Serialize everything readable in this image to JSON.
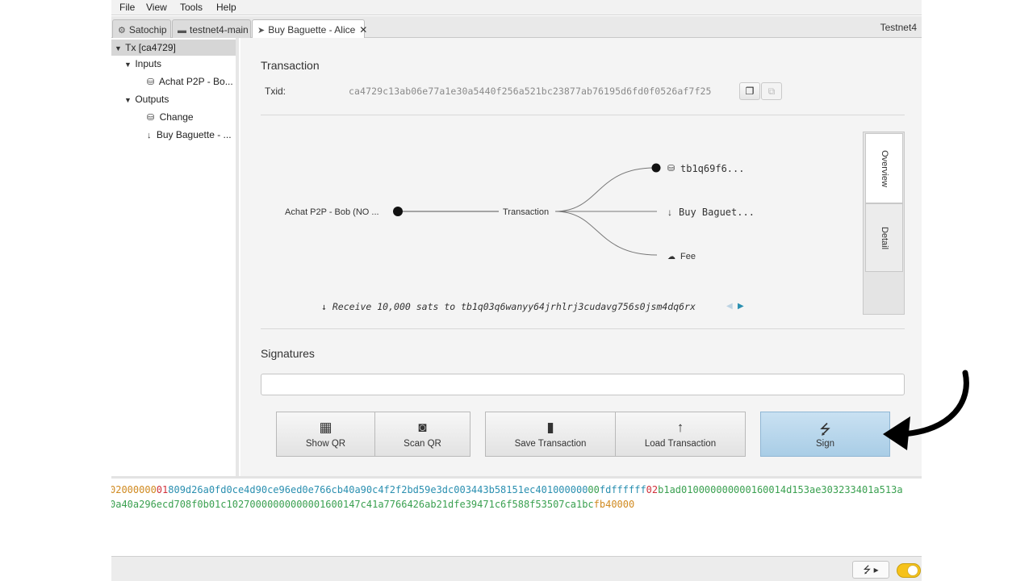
{
  "menu": [
    "File",
    "View",
    "Tools",
    "Help"
  ],
  "tabs": [
    {
      "label": "Satochip",
      "icon": "satochip-icon"
    },
    {
      "label": "testnet4-main",
      "icon": "wallet-icon"
    },
    {
      "label": "Buy Baguette - Alice",
      "icon": "send-icon",
      "close": "✕"
    }
  ],
  "network": "Testnet4",
  "tree": {
    "root": "Tx [ca4729]",
    "inputs_label": "Inputs",
    "input_item": "Achat P2P - Bo...",
    "outputs_label": "Outputs",
    "output_change": "Change",
    "output_payment": "Buy Baguette - ..."
  },
  "transaction": {
    "title": "Transaction",
    "txid_label": "Txid:",
    "txid": "ca4729c13ab06e77a1e30a5440f256a521bc23877ab76195d6fd0f0526af7f25"
  },
  "diagram": {
    "input_label": "Achat P2P - Bob (NO ...",
    "center_label": "Transaction",
    "out1": "tb1q69f6...",
    "out2": "Buy Baguet...",
    "out3": "Fee",
    "side_tab_overview": "Overview",
    "side_tab_detail": "Detail",
    "receive_text": "Receive 10,000 sats to tb1q03q6wanyy64jrhlrj3cudavg756s0jsm4dq6rx"
  },
  "signatures": {
    "title": "Signatures"
  },
  "buttons": {
    "show_qr": "Show QR",
    "scan_qr": "Scan QR",
    "save_tx": "Save Transaction",
    "load_tx": "Load Transaction",
    "sign": "Sign"
  },
  "hex": {
    "line1": [
      {
        "text": "02000000",
        "color": "#d08a20"
      },
      {
        "text": "01",
        "color": "#d0303a"
      },
      {
        "text": "809d26a0fd0ce4d90ce96ed0e766cb40a90c4f2f2bd59e3dc003443b58151ec4",
        "color": "#2a8fb0"
      },
      {
        "text": "01000000",
        "color": "#2a8fb0"
      },
      {
        "text": "00",
        "color": "#3aa050"
      },
      {
        "text": "fdffffff",
        "color": "#2a8fb0"
      },
      {
        "text": "02",
        "color": "#d0303a"
      },
      {
        "text": "b1ad010000000000160014d153ae303233401a513a",
        "color": "#3aa050"
      }
    ],
    "line2": [
      {
        "text": "0a40a296ecd708f0b01c10270000000000001600147c41a7766426ab21dfe39471c6f588f53507ca1bc",
        "color": "#3aa050"
      },
      {
        "text": "fb40000",
        "color": "#d08a20"
      }
    ]
  },
  "colors": {
    "sign_button": "#a9cde6",
    "toggle": "#f6c21a",
    "accent": "#2a8fb0"
  }
}
